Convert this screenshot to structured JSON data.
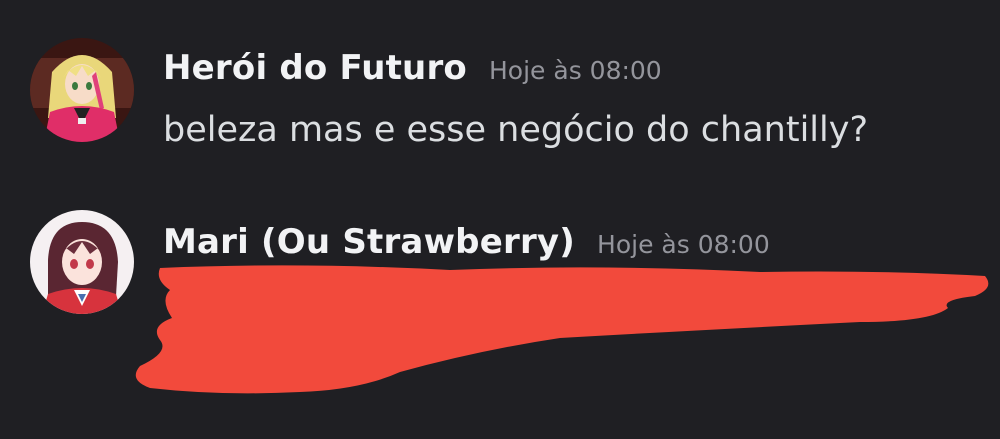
{
  "messages": [
    {
      "author": "Herói do Futuro",
      "timestamp": "Hoje às 08:00",
      "content": "beleza mas e esse negócio do chantilly?"
    },
    {
      "author": "Mari (Ou Strawberry)",
      "timestamp": "Hoje às 08:00",
      "content": ""
    }
  ],
  "colors": {
    "background": "#1f1f23",
    "username": "#f2f3f5",
    "timestamp": "#94959c",
    "message_text": "#dbdee1",
    "redaction": "#f24a3c"
  }
}
